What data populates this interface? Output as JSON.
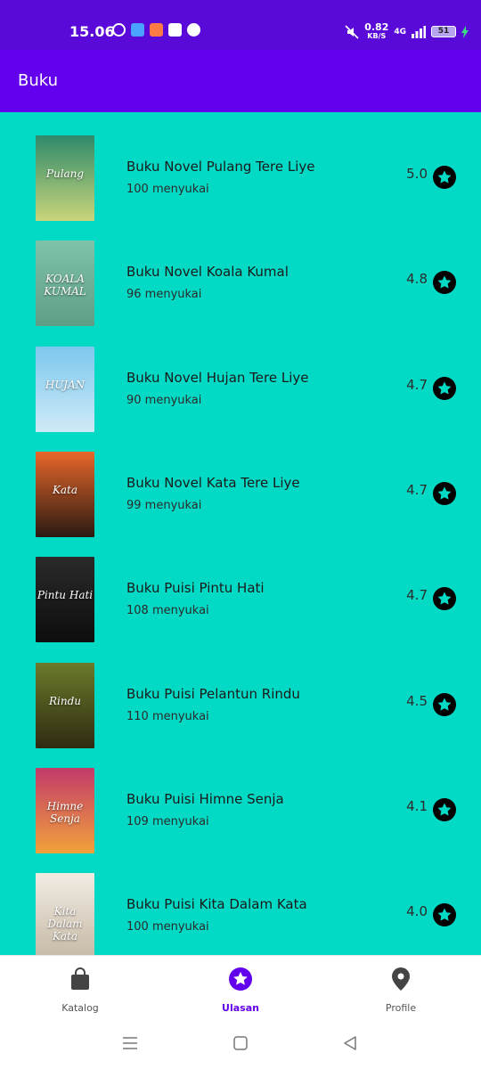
{
  "status_bar": {
    "time": "15.06",
    "network_speed": "0.82",
    "network_unit": "KB/S",
    "network_type": "4G",
    "battery": "51"
  },
  "app_bar": {
    "title": "Buku"
  },
  "books": [
    {
      "title": "Buku Novel Pulang Tere Liye",
      "likes": "100 menyukai",
      "rating": "5.0",
      "cover_text": "Pulang",
      "cover_colors": [
        "#2e8a6b",
        "#c9d57a"
      ]
    },
    {
      "title": "Buku Novel Koala Kumal",
      "likes": "96 menyukai",
      "rating": "4.8",
      "cover_text": "KOALA KUMAL",
      "cover_colors": [
        "#7fc3a9",
        "#5f9e86"
      ]
    },
    {
      "title": "Buku Novel Hujan Tere Liye",
      "likes": "90 menyukai",
      "rating": "4.7",
      "cover_text": "HUJAN",
      "cover_colors": [
        "#7cc8ee",
        "#cfeaf7"
      ]
    },
    {
      "title": "Buku Novel Kata Tere Liye",
      "likes": "99 menyukai",
      "rating": "4.7",
      "cover_text": "Kata",
      "cover_colors": [
        "#e9672a",
        "#2a1a12"
      ]
    },
    {
      "title": "Buku Puisi Pintu Hati",
      "likes": "108 menyukai",
      "rating": "4.7",
      "cover_text": "Pintu Hati",
      "cover_colors": [
        "#2a2a2a",
        "#0d0d0d"
      ]
    },
    {
      "title": "Buku Puisi Pelantun Rindu",
      "likes": "110 menyukai",
      "rating": "4.5",
      "cover_text": "Rindu",
      "cover_colors": [
        "#6b7b2a",
        "#2f2a12"
      ]
    },
    {
      "title": "Buku Puisi Himne Senja",
      "likes": "109 menyukai",
      "rating": "4.1",
      "cover_text": "Himne Senja",
      "cover_colors": [
        "#c33a6a",
        "#f0a23a"
      ]
    },
    {
      "title": "Buku Puisi Kita Dalam Kata",
      "likes": "100 menyukai",
      "rating": "4.0",
      "cover_text": "Kita Dalam Kata",
      "cover_colors": [
        "#f1ece3",
        "#c6b9a6"
      ]
    }
  ],
  "bottom_nav": [
    {
      "label": "Katalog",
      "icon": "shopping-bag-icon",
      "active": false
    },
    {
      "label": "Ulasan",
      "icon": "star-icon",
      "active": true
    },
    {
      "label": "Profile",
      "icon": "location-pin-icon",
      "active": false
    }
  ],
  "colors": {
    "primary": "#6200ee",
    "status_bar": "#5a0ad8",
    "list_background": "#03dac5"
  }
}
